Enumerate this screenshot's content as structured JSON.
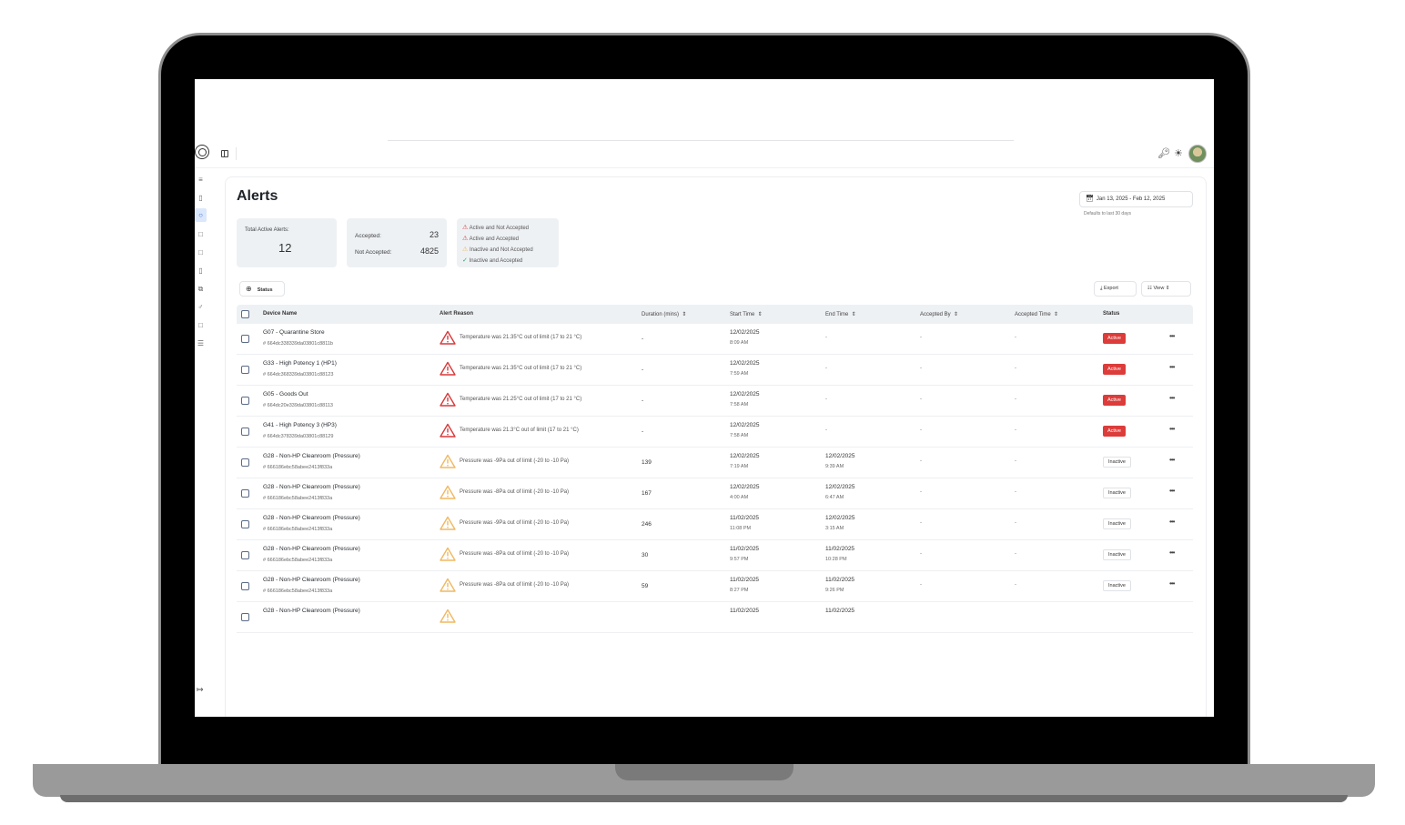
{
  "page": {
    "title": "Alerts",
    "date_range": "Jan 13, 2025 - Feb 12, 2025",
    "date_hint": "Defaults to last 30 days"
  },
  "stats": {
    "total_label": "Total Active Alerts:",
    "total_value": "12",
    "accepted_label": "Accepted:",
    "accepted_value": "23",
    "not_accepted_label": "Not Accepted:",
    "not_accepted_value": "4825"
  },
  "legend": {
    "active_not_accepted": "Active and Not Accepted",
    "active_accepted": "Active and Accepted",
    "inactive_not_accepted": "Inactive and Not Accepted",
    "inactive_accepted": "Inactive and Accepted"
  },
  "toolbar": {
    "status_filter": "Status",
    "export": "Export",
    "view": "View"
  },
  "table": {
    "headers": {
      "device_name": "Device Name",
      "alert_reason": "Alert Reason",
      "duration": "Duration (mins)",
      "start_time": "Start Time",
      "end_time": "End Time",
      "accepted_by": "Accepted By",
      "accepted_time": "Accepted Time",
      "status": "Status"
    },
    "rows": [
      {
        "device": "G07 - Quarantine Store",
        "id": "# 664dc338339da03801c8811b",
        "reason": "Temperature was 21.35°C out of limit (17 to 21 °C)",
        "duration": "-",
        "start_date": "12/02/2025",
        "start_time": "8:09 AM",
        "end_date": "-",
        "end_time": "",
        "accepted_by": "-",
        "accepted_time": "-",
        "status": "Active",
        "severity": "red"
      },
      {
        "device": "G33 - High Potency 1 (HP1)",
        "id": "# 664dc368339da03801c88123",
        "reason": "Temperature was 21.35°C out of limit (17 to 21 °C)",
        "duration": "-",
        "start_date": "12/02/2025",
        "start_time": "7:59 AM",
        "end_date": "-",
        "end_time": "",
        "accepted_by": "-",
        "accepted_time": "-",
        "status": "Active",
        "severity": "red"
      },
      {
        "device": "G05 - Goods Out",
        "id": "# 664dc20e339da03801c88113",
        "reason": "Temperature was 21.25°C out of limit (17 to 21 °C)",
        "duration": "-",
        "start_date": "12/02/2025",
        "start_time": "7:58 AM",
        "end_date": "-",
        "end_time": "",
        "accepted_by": "-",
        "accepted_time": "-",
        "status": "Active",
        "severity": "red"
      },
      {
        "device": "G41 - High Potency 3 (HP3)",
        "id": "# 664dc378339da03801c88129",
        "reason": "Temperature was 21.3°C out of limit (17 to 21 °C)",
        "duration": "-",
        "start_date": "12/02/2025",
        "start_time": "7:58 AM",
        "end_date": "-",
        "end_time": "",
        "accepted_by": "-",
        "accepted_time": "-",
        "status": "Active",
        "severity": "red"
      },
      {
        "device": "G28 - Non-HP Cleanroom (Pressure)",
        "id": "# 666186ebc58abee2413f833a",
        "reason": "Pressure was -9Pa out of limit (-20 to -10 Pa)",
        "duration": "139",
        "start_date": "12/02/2025",
        "start_time": "7:19 AM",
        "end_date": "12/02/2025",
        "end_time": "9:39 AM",
        "accepted_by": "-",
        "accepted_time": "-",
        "status": "Inactive",
        "severity": "amber"
      },
      {
        "device": "G28 - Non-HP Cleanroom (Pressure)",
        "id": "# 666186ebc58abee2413f833a",
        "reason": "Pressure was -8Pa out of limit (-20 to -10 Pa)",
        "duration": "167",
        "start_date": "12/02/2025",
        "start_time": "4:00 AM",
        "end_date": "12/02/2025",
        "end_time": "6:47 AM",
        "accepted_by": "-",
        "accepted_time": "-",
        "status": "Inactive",
        "severity": "amber"
      },
      {
        "device": "G28 - Non-HP Cleanroom (Pressure)",
        "id": "# 666186ebc58abee2413f833a",
        "reason": "Pressure was -9Pa out of limit (-20 to -10 Pa)",
        "duration": "246",
        "start_date": "11/02/2025",
        "start_time": "11:08 PM",
        "end_date": "12/02/2025",
        "end_time": "3:15 AM",
        "accepted_by": "-",
        "accepted_time": "-",
        "status": "Inactive",
        "severity": "amber"
      },
      {
        "device": "G28 - Non-HP Cleanroom (Pressure)",
        "id": "# 666186ebc58abee2413f833a",
        "reason": "Pressure was -8Pa out of limit (-20 to -10 Pa)",
        "duration": "30",
        "start_date": "11/02/2025",
        "start_time": "9:57 PM",
        "end_date": "11/02/2025",
        "end_time": "10:28 PM",
        "accepted_by": "-",
        "accepted_time": "-",
        "status": "Inactive",
        "severity": "amber"
      },
      {
        "device": "G28 - Non-HP Cleanroom (Pressure)",
        "id": "# 666186ebc58abee2413f833a",
        "reason": "Pressure was -8Pa out of limit (-20 to -10 Pa)",
        "duration": "59",
        "start_date": "11/02/2025",
        "start_time": "8:27 PM",
        "end_date": "11/02/2025",
        "end_time": "9:26 PM",
        "accepted_by": "-",
        "accepted_time": "-",
        "status": "Inactive",
        "severity": "amber"
      },
      {
        "device": "G28 - Non-HP Cleanroom (Pressure)",
        "id": "",
        "reason": "",
        "duration": "",
        "start_date": "11/02/2025",
        "start_time": "",
        "end_date": "11/02/2025",
        "end_time": "",
        "accepted_by": "",
        "accepted_time": "",
        "status": "",
        "severity": "amber"
      }
    ]
  },
  "colors": {
    "active_badge": "#dc3c3a",
    "warn_red": "#d9383a",
    "warn_amber": "#f0b861",
    "accent": "#2d6be0"
  },
  "icons": {
    "sidebar": [
      "menu-icon",
      "clipboard-icon",
      "alert-icon",
      "book-icon",
      "book-icon",
      "device-icon",
      "copy-icon",
      "user-icon",
      "book-icon",
      "list-icon"
    ],
    "logout": "logout-icon"
  }
}
